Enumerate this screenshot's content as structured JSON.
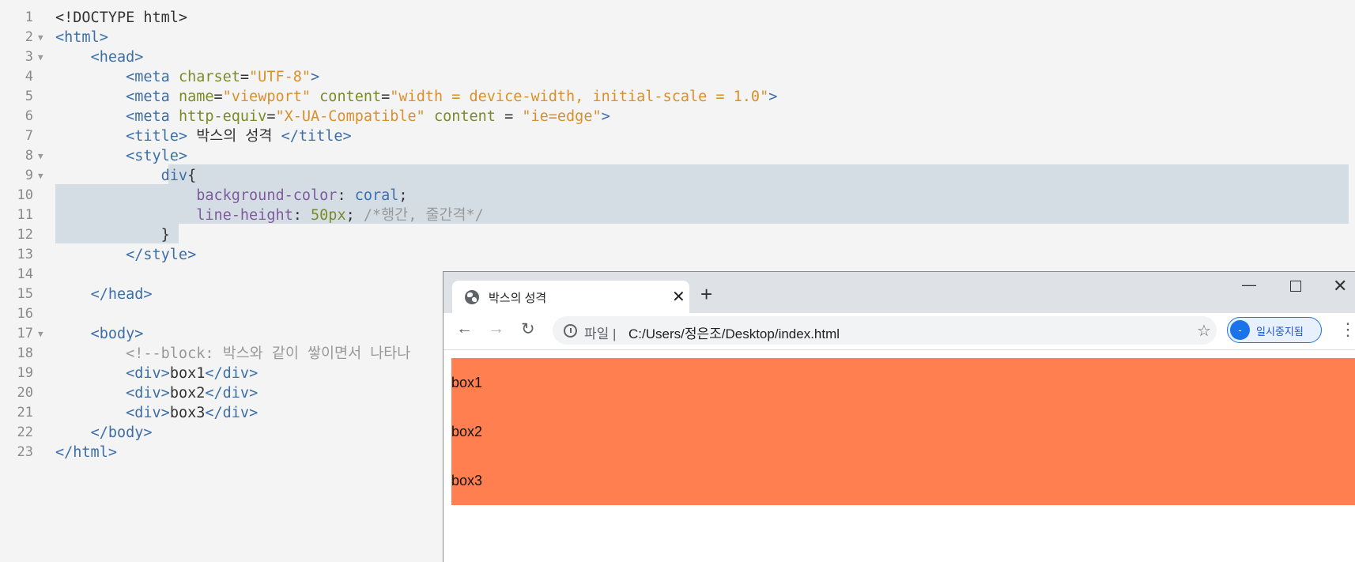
{
  "editor": {
    "lines": [
      {
        "num": "1",
        "fold": false,
        "tokens": [
          {
            "c": "txt",
            "t": "<!DOCTYPE html>"
          }
        ]
      },
      {
        "num": "2",
        "fold": true,
        "tokens": [
          {
            "c": "tag",
            "t": "<html>"
          }
        ]
      },
      {
        "num": "3",
        "fold": true,
        "tokens": [
          {
            "c": "txt",
            "t": "    "
          },
          {
            "c": "tag",
            "t": "<head>"
          }
        ]
      },
      {
        "num": "4",
        "fold": false,
        "tokens": [
          {
            "c": "txt",
            "t": "        "
          },
          {
            "c": "tag",
            "t": "<meta "
          },
          {
            "c": "attr",
            "t": "charset"
          },
          {
            "c": "txt",
            "t": "="
          },
          {
            "c": "str",
            "t": "\"UTF-8\""
          },
          {
            "c": "tag",
            "t": ">"
          }
        ]
      },
      {
        "num": "5",
        "fold": false,
        "tokens": [
          {
            "c": "txt",
            "t": "        "
          },
          {
            "c": "tag",
            "t": "<meta "
          },
          {
            "c": "attr",
            "t": "name"
          },
          {
            "c": "txt",
            "t": "="
          },
          {
            "c": "str",
            "t": "\"viewport\""
          },
          {
            "c": "txt",
            "t": " "
          },
          {
            "c": "attr",
            "t": "content"
          },
          {
            "c": "txt",
            "t": "="
          },
          {
            "c": "str",
            "t": "\"width = device-width, initial-scale = 1.0\""
          },
          {
            "c": "tag",
            "t": ">"
          }
        ]
      },
      {
        "num": "6",
        "fold": false,
        "tokens": [
          {
            "c": "txt",
            "t": "        "
          },
          {
            "c": "tag",
            "t": "<meta "
          },
          {
            "c": "attr",
            "t": "http-equiv"
          },
          {
            "c": "txt",
            "t": "="
          },
          {
            "c": "str",
            "t": "\"X-UA-Compatible\""
          },
          {
            "c": "txt",
            "t": " "
          },
          {
            "c": "attr",
            "t": "content"
          },
          {
            "c": "txt",
            "t": " = "
          },
          {
            "c": "str",
            "t": "\"ie=edge\""
          },
          {
            "c": "tag",
            "t": ">"
          }
        ]
      },
      {
        "num": "7",
        "fold": false,
        "tokens": [
          {
            "c": "txt",
            "t": "        "
          },
          {
            "c": "tag",
            "t": "<title>"
          },
          {
            "c": "txt",
            "t": " 박스의 성격 "
          },
          {
            "c": "tag",
            "t": "</title>"
          }
        ]
      },
      {
        "num": "8",
        "fold": true,
        "tokens": [
          {
            "c": "txt",
            "t": "        "
          },
          {
            "c": "tag",
            "t": "<style>"
          }
        ]
      },
      {
        "num": "9",
        "fold": true,
        "tokens": [
          {
            "c": "txt",
            "t": "            "
          },
          {
            "c": "tag",
            "t": "div"
          },
          {
            "c": "txt",
            "t": "{"
          }
        ]
      },
      {
        "num": "10",
        "fold": false,
        "tokens": [
          {
            "c": "txt",
            "t": "                "
          },
          {
            "c": "prop",
            "t": "background-color"
          },
          {
            "c": "txt",
            "t": ": "
          },
          {
            "c": "val",
            "t": "coral"
          },
          {
            "c": "txt",
            "t": ";"
          }
        ]
      },
      {
        "num": "11",
        "fold": false,
        "tokens": [
          {
            "c": "txt",
            "t": "                "
          },
          {
            "c": "prop",
            "t": "line-height"
          },
          {
            "c": "txt",
            "t": ": "
          },
          {
            "c": "num",
            "t": "50px"
          },
          {
            "c": "txt",
            "t": "; "
          },
          {
            "c": "cmt",
            "t": "/*행간, 줄간격*/"
          }
        ]
      },
      {
        "num": "12",
        "fold": false,
        "tokens": [
          {
            "c": "txt",
            "t": "            }"
          }
        ]
      },
      {
        "num": "13",
        "fold": false,
        "tokens": [
          {
            "c": "txt",
            "t": "        "
          },
          {
            "c": "tag",
            "t": "</style>"
          }
        ]
      },
      {
        "num": "14",
        "fold": false,
        "tokens": []
      },
      {
        "num": "15",
        "fold": false,
        "tokens": [
          {
            "c": "txt",
            "t": "    "
          },
          {
            "c": "tag",
            "t": "</head>"
          }
        ]
      },
      {
        "num": "16",
        "fold": false,
        "tokens": []
      },
      {
        "num": "17",
        "fold": true,
        "tokens": [
          {
            "c": "txt",
            "t": "    "
          },
          {
            "c": "tag",
            "t": "<body>"
          }
        ]
      },
      {
        "num": "18",
        "fold": false,
        "tokens": [
          {
            "c": "txt",
            "t": "        "
          },
          {
            "c": "cmt",
            "t": "<!--block: 박스와 같이 쌓이면서 나타나"
          }
        ]
      },
      {
        "num": "19",
        "fold": false,
        "tokens": [
          {
            "c": "txt",
            "t": "        "
          },
          {
            "c": "tag",
            "t": "<div>"
          },
          {
            "c": "txt",
            "t": "box1"
          },
          {
            "c": "tag",
            "t": "</div>"
          }
        ]
      },
      {
        "num": "20",
        "fold": false,
        "tokens": [
          {
            "c": "txt",
            "t": "        "
          },
          {
            "c": "tag",
            "t": "<div>"
          },
          {
            "c": "txt",
            "t": "box2"
          },
          {
            "c": "tag",
            "t": "</div>"
          }
        ]
      },
      {
        "num": "21",
        "fold": false,
        "tokens": [
          {
            "c": "txt",
            "t": "        "
          },
          {
            "c": "tag",
            "t": "<div>"
          },
          {
            "c": "txt",
            "t": "box3"
          },
          {
            "c": "tag",
            "t": "</div>"
          }
        ]
      },
      {
        "num": "22",
        "fold": false,
        "tokens": [
          {
            "c": "txt",
            "t": "    "
          },
          {
            "c": "tag",
            "t": "</body>"
          }
        ]
      },
      {
        "num": "23",
        "fold": false,
        "tokens": [
          {
            "c": "tag",
            "t": "</html>"
          }
        ]
      }
    ],
    "colors": {
      "selection": "#d5dde4",
      "tag": "#3c6fa8",
      "attr": "#7a8b28",
      "string": "#d9902c",
      "property": "#7e5c9c"
    }
  },
  "browser": {
    "tab_title": "박스의 성격",
    "tab_icon": "globe-icon",
    "tab_close": "✕",
    "new_tab": "+",
    "win_min": "—",
    "win_close": "✕",
    "back": "←",
    "forward": "→",
    "reload": "↻",
    "scheme": "파일",
    "separator": "|",
    "url": "C:/Users/정은조/Desktop/index.html",
    "star": "☆",
    "paused_avatar": "-",
    "paused_label": "일시중지됨",
    "menu": "⋮",
    "boxes": [
      "box1",
      "box2",
      "box3"
    ],
    "box_color": "#ff7f50"
  }
}
